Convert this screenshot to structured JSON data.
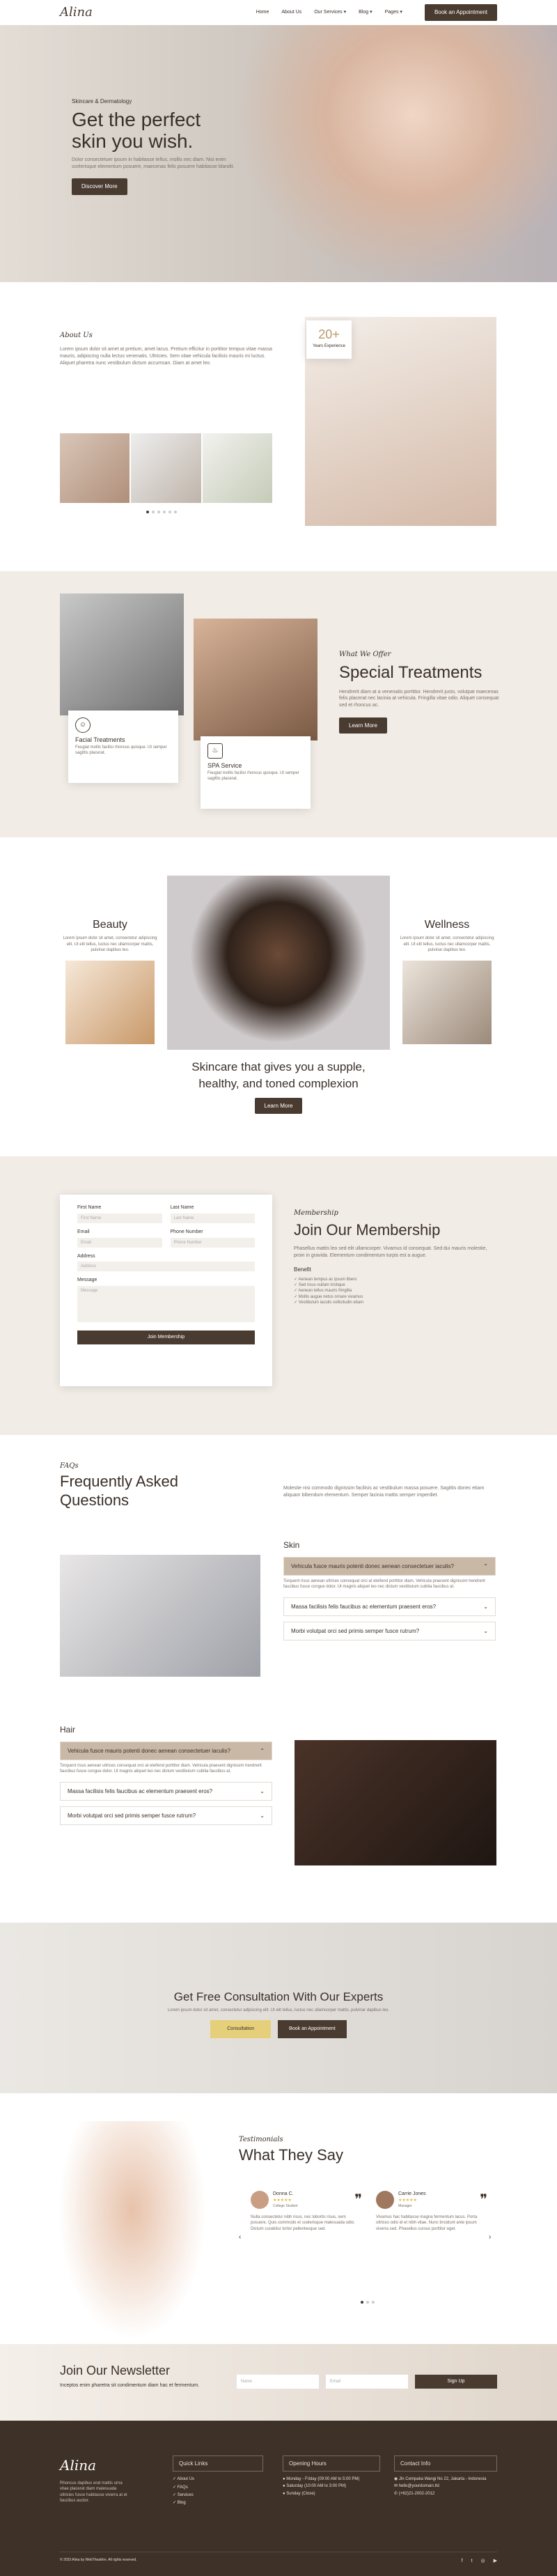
{
  "nav": {
    "logo": "Alina",
    "items": [
      "Home",
      "About Us",
      "Our Services",
      "Blog",
      "Pages"
    ],
    "cta": "Book an Appointment"
  },
  "hero": {
    "eyebrow": "Skincare & Dermatology",
    "title_1": "Get the perfect",
    "title_2": "skin you wish.",
    "text": "Dolor consectetuer ipsum in habitasse tellus, mollis nec diam. Nisi enim scelerisque elementum posuere, maecenas felis posuere habitasse blandit.",
    "button": "Discover More"
  },
  "about": {
    "eyebrow": "About Us",
    "text": "Lorem ipsum dolor sit amet at pretium, amet lacus. Pretium efficitur in porttitor tempus vitae massa mauris, adipiscing nulla lectus venenatis. Ultricies. Sem vitae vehicula facilisis mauris mi luctus. Aliquet pharetra nunc vestibulum dictum accumsan. Diam at amet leo.",
    "badge_num": "20+",
    "badge_text": "Years Experience"
  },
  "treatments": {
    "eyebrow": "What We Offer",
    "title": "Special Treatments",
    "text": "Hendrerit diam at a venenatis porttitor. Hendrerit justo, volutpat maecenas felis placerat nec lacinia at vehicula. Fringilla vitae odio. Aliquet consequat sed et rhoncus ac.",
    "button": "Learn More",
    "card1_title": "Facial Treatments",
    "card1_text": "Feugiat mollis facilisi rhoncus quisque. Ut semper sagittis placerat.",
    "card2_title": "SPA Service",
    "card2_text": "Feugiat mollis facilisi rhoncus quisque. Ut semper sagittis placerat."
  },
  "beauty": {
    "left_title": "Beauty",
    "left_text": "Lorem ipsum dolor sit amet, consectetur adipiscing elit. Ut elit tellus, luctus nec ullamcorper mattis, pulvinar dapibus leo.",
    "right_title": "Wellness",
    "right_text": "Lorem ipsum dolor sit amet, consectetur adipiscing elit. Ut elit tellus, luctus nec ullamcorper mattis, pulvinar dapibus leo.",
    "headline_1": "Skincare that gives you a supple,",
    "headline_2": "healthy, and toned complexion",
    "button": "Learn More"
  },
  "membership": {
    "eyebrow": "Membership",
    "title": "Join Our Membership",
    "text": "Phasellus mattis leo sed elit ullamcorper. Vivamus id consequat. Sed dui mauris molestie, proin in gravida. Elementum condimentum turpis est a augue.",
    "benefit_label": "Benefit",
    "benefits": [
      "Aenean tempus ac ipsum libero",
      "Sed risus nullam tristique",
      "Aenean tellus mauris fringilla",
      "Mollis augue netus ornare vivamus",
      "Vestibulum iaculis sollicitudin etiam"
    ],
    "form": {
      "first": "First Name",
      "last": "Last Name",
      "email": "Email",
      "phone": "Phone Number",
      "address": "Address",
      "message": "Message",
      "ph_first": "First Name",
      "ph_last": "Last Name",
      "ph_email": "Email",
      "ph_phone": "Phone Number",
      "ph_address": "Address",
      "ph_message": "Message",
      "submit": "Join Membership"
    }
  },
  "faq": {
    "eyebrow": "FAQs",
    "title_1": "Frequently Asked",
    "title_2": "Questions",
    "text": "Molestie nisi commodo dignissim facilisis ac vestibulum massa posuere. Sagittis donec etiam aliquam bibendum elementum. Semper lacinia mattis semper imperdiet.",
    "skin_label": "Skin",
    "hair_label": "Hair",
    "skin_q1": "Vehicula fusce mauris potenti donec aenean consectetuer iaculis?",
    "skin_a1": "Torquent risus aenean ultrices consequat orci at eleifend porttitor diam. Vehicula praesent dignissim hendrerit faucibus fusce congue dolor. Ut magnis aliquet leo nec dictum vestibulum cubilia faucibus at.",
    "skin_q2": "Massa facilisis felis faucibus ac elementum praesent eros?",
    "skin_q3": "Morbi volutpat orci sed primis semper fusce rutrum?",
    "hair_q1": "Vehicula fusce mauris potenti donec aenean consectetuer iaculis?",
    "hair_a1": "Torquent risus aenean ultrices consequat orci at eleifend porttitor diam. Vehicula praesent dignissim hendrerit faucibus fusce congue dolor. Ut magnis aliquet leo nec dictum vestibulum cubilia faucibus at.",
    "hair_q2": "Massa facilisis felis faucibus ac elementum praesent eros?",
    "hair_q3": "Morbi volutpat orci sed primis semper fusce rutrum?"
  },
  "consult": {
    "title": "Get Free Consultation With Our Experts",
    "text": "Lorem ipsum dolor sit amet, consectetur adipiscing elit. Ut elit tellus, luctus nec ullamcorper mattis, pulvinar dapibus leo.",
    "btn1": "Consultation",
    "btn2": "Book an Appointment"
  },
  "testimonials": {
    "eyebrow": "Testimonials",
    "title": "What They Say",
    "t1_name": "Donna C.",
    "t1_role": "College Student",
    "t1_text": "Nulla consectetur nibh risus, nec lobortis risus, sem posuere. Quis commodo et scelerisque malesuada odio. Dictum curabitur tortor pellentesque sed.",
    "t2_name": "Carrie Jones",
    "t2_role": "Manager",
    "t2_text": "Vivamus hac habitasse magna fermentum lacus. Porta ultrices odio id et nibh vitae. Nunc tincidunt ante ipsum viverra sed. Phasellus cursus porttitor eget."
  },
  "newsletter": {
    "title": "Join Our Newsletter",
    "text": "Inceptos enim pharetra sit condimentum diam hac et fermentum.",
    "ph_name": "Name",
    "ph_email": "Email",
    "button": "Sign Up"
  },
  "footer": {
    "logo": "Alina",
    "about": "Rhoncus dapibus erat mattis urna vitae placerat diam malesuada ultricies fusce habitasse viverra at et faucibus auctor.",
    "quick_links": "Quick Links",
    "links": [
      "About Us",
      "FAQs",
      "Services",
      "Blog"
    ],
    "hours_label": "Opening Hours",
    "hours": [
      "Monday - Friday (09:00 AM to 5:00 PM)",
      "Saturday (10:00 AM to 3:00 PM)",
      "Sunday (Close)"
    ],
    "contact_label": "Contact Info",
    "contact": [
      "Jln Cempaka Wangi No 22, Jakarta - Indonesia",
      "hello@yourdomain.tld",
      "(+62)21-2002-2012"
    ],
    "copyright": "© 2023 Alina by WebTheathre. All rights reserved."
  },
  "colors": {
    "brown": "#4a3b30",
    "beige": "#f1ece6",
    "gold": "#e6cf7a"
  }
}
